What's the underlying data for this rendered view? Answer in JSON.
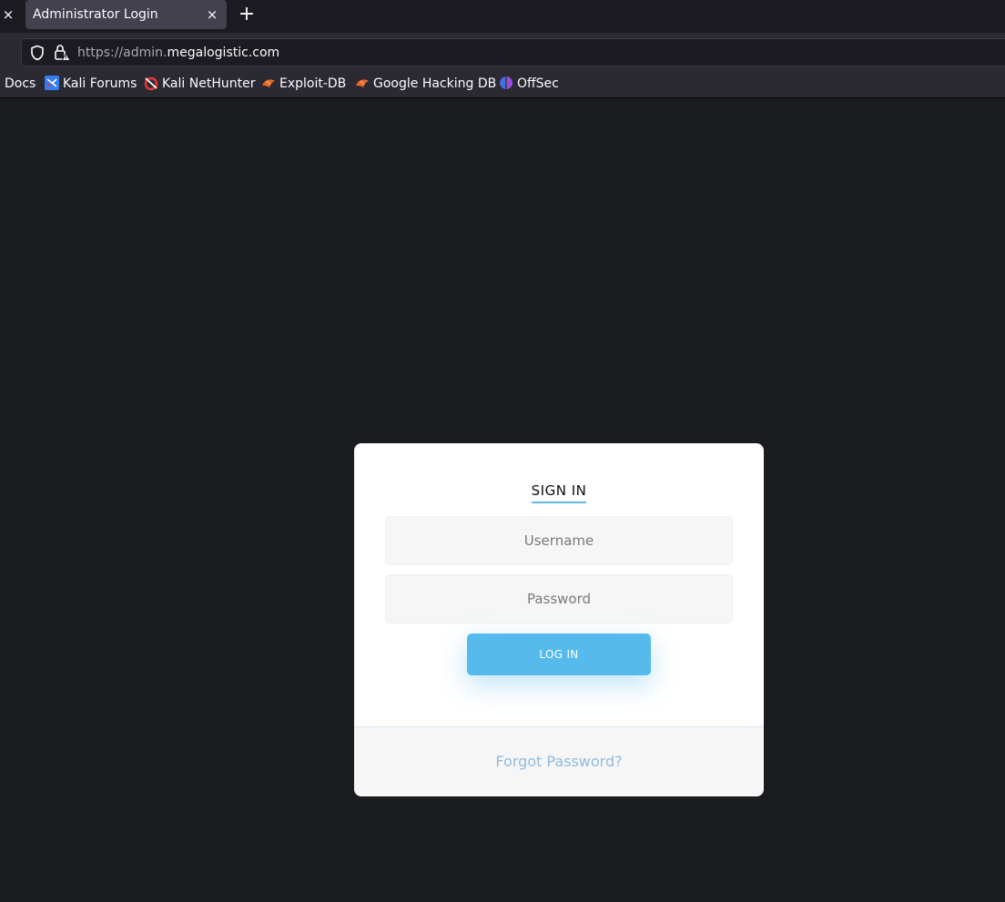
{
  "browser": {
    "tab": {
      "title": "Administrator Login",
      "close_glyph": "×"
    },
    "left_tab_close_glyph": "×",
    "new_tab_glyph": "+",
    "url": {
      "prefix": "https://admin.",
      "host": "megalogistic.com"
    },
    "bookmarks": [
      {
        "label": "Docs",
        "icon": ""
      },
      {
        "label": "Kali Forums",
        "icon": "kali-forums-icon"
      },
      {
        "label": "Kali NetHunter",
        "icon": "kali-nethunter-icon"
      },
      {
        "label": "Exploit-DB",
        "icon": "exploit-db-icon"
      },
      {
        "label": "Google Hacking DB",
        "icon": "exploit-db-icon"
      },
      {
        "label": "OffSec",
        "icon": "offsec-icon"
      }
    ]
  },
  "login": {
    "title": "SIGN IN",
    "username": {
      "placeholder": "Username",
      "value": ""
    },
    "password": {
      "placeholder": "Password",
      "value": ""
    },
    "submit_label": "LOG IN",
    "forgot_label": "Forgot Password?"
  },
  "colors": {
    "page_bg": "#1b1c1f",
    "accent": "#56baed",
    "link": "#92badd",
    "card_bg": "#ffffff"
  }
}
